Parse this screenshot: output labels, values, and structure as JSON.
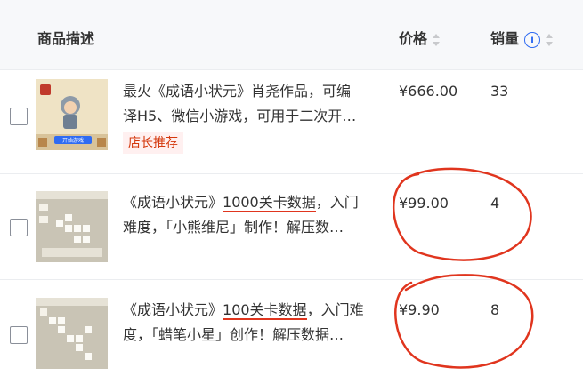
{
  "header": {
    "col_desc": "商品描述",
    "col_price": "价格",
    "col_sales": "销量",
    "info_icon": "i"
  },
  "rows": [
    {
      "desc_line1": "最火《成语小状元》肖尧作品，可编",
      "desc_line2": "译H5、微信小游戏，可用于二次开…",
      "tag": "店长推荐",
      "price": "¥666.00",
      "sales": "33"
    },
    {
      "desc_pre": "《成语小状元》",
      "desc_highlight": "1000关卡数据",
      "desc_post": "，入门",
      "desc_line2": "难度，「小熊维尼」制作！解压数…",
      "price": "¥99.00",
      "sales": "4"
    },
    {
      "desc_pre": "《成语小状元》",
      "desc_highlight": "100关卡数据",
      "desc_post": "，入门难",
      "desc_line2": "度，「蜡笔小星」创作！解压数据…",
      "price": "¥9.90",
      "sales": "8"
    }
  ],
  "thumb1": {
    "button_text": "开始游戏"
  },
  "colors": {
    "accent": "#2f6bf2",
    "annotation": "#e0351e",
    "tag_text": "#d4380d"
  }
}
